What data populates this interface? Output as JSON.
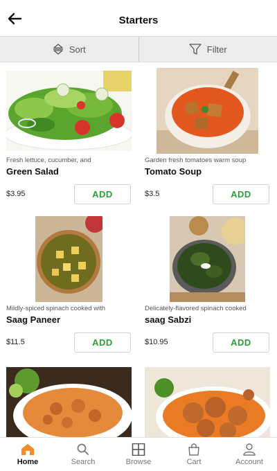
{
  "header": {
    "title": "Starters",
    "back_icon": "arrow-left-icon"
  },
  "sortbar": {
    "sort_label": "Sort",
    "filter_label": "Filter",
    "sort_icon": "sort-icon",
    "filter_icon": "filter-icon"
  },
  "products": [
    {
      "desc": "Fresh lettuce, cucumber, and",
      "name": "Green Salad",
      "price": "$3.95",
      "add": "ADD"
    },
    {
      "desc": "Garden fresh tomatoes warm soup",
      "name": "Tomato Soup",
      "price": "$3.5",
      "add": "ADD"
    },
    {
      "desc": "Mildly-spiced spinach cooked with",
      "name": "Saag Paneer",
      "price": "$11.5",
      "add": "ADD"
    },
    {
      "desc": "Delicately-flavored spinach cooked",
      "name": "saag Sabzi",
      "price": "$10.95",
      "add": "ADD"
    },
    {
      "desc": "",
      "name": "",
      "price": "",
      "add": ""
    },
    {
      "desc": "",
      "name": "",
      "price": "",
      "add": ""
    }
  ],
  "tabs": [
    {
      "label": "Home",
      "icon": "home-icon",
      "active": true
    },
    {
      "label": "Search",
      "icon": "search-icon",
      "active": false
    },
    {
      "label": "Browse",
      "icon": "grid-icon",
      "active": false
    },
    {
      "label": "Cart",
      "icon": "bag-icon",
      "active": false
    },
    {
      "label": "Account",
      "icon": "person-icon",
      "active": false
    }
  ],
  "colors": {
    "accent": "#f28a2e",
    "add_green": "#2e9e3a",
    "bar_gray": "#ececec"
  }
}
